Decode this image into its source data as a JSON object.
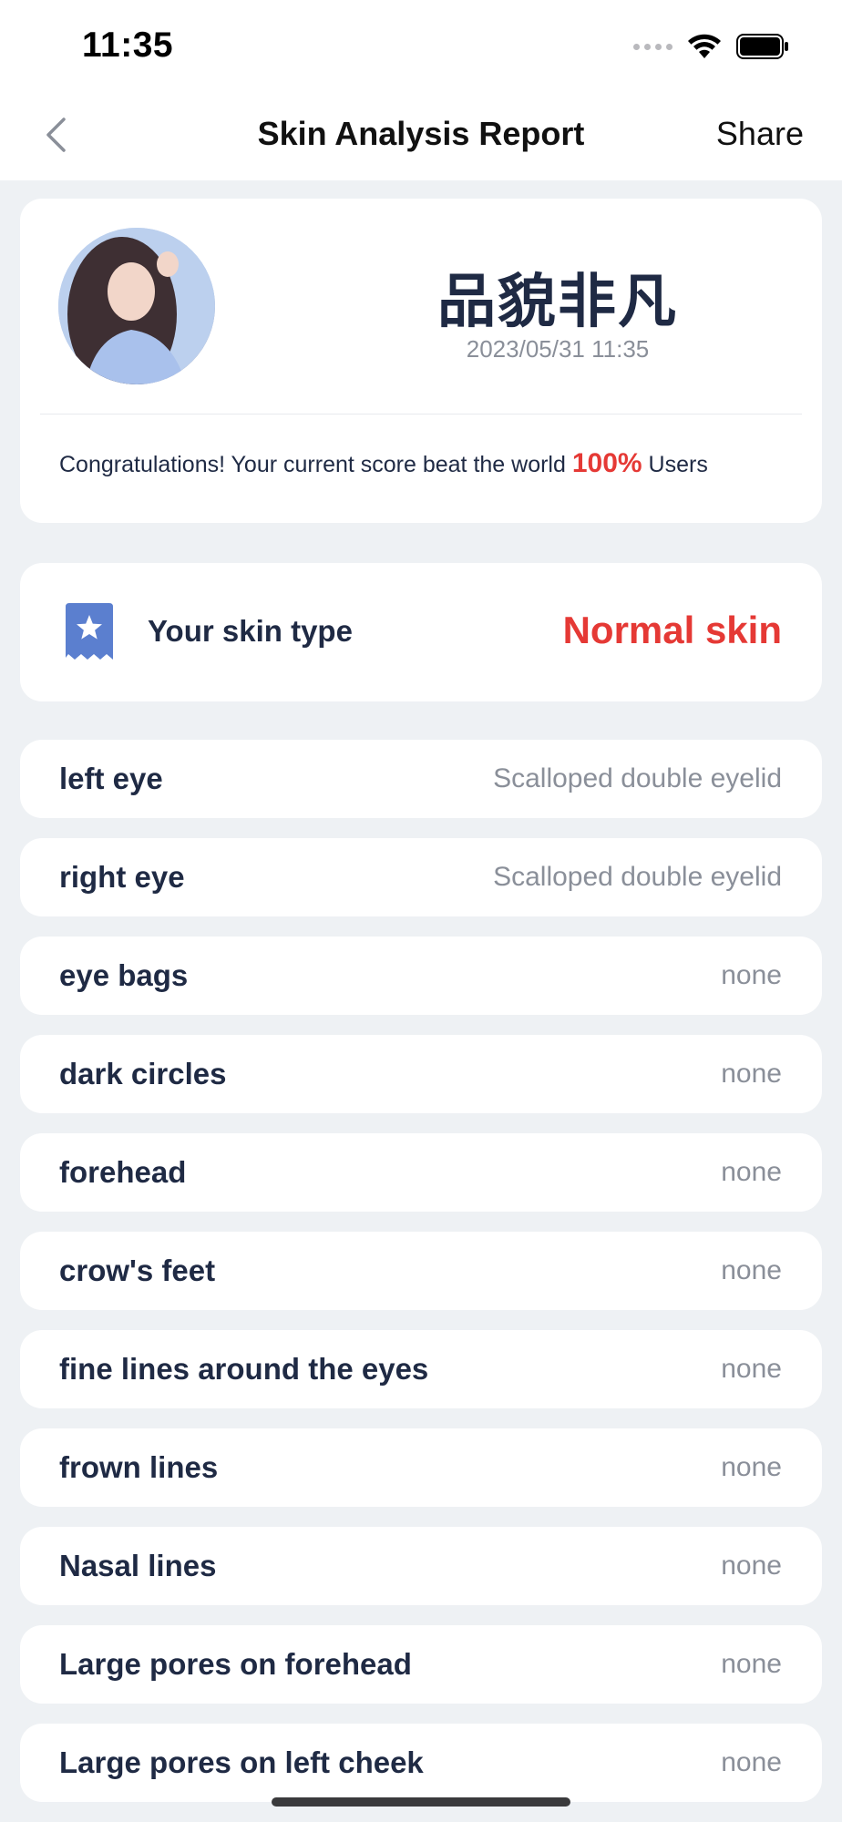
{
  "status_bar": {
    "time": "11:35"
  },
  "nav": {
    "title": "Skin Analysis Report",
    "share_label": "Share"
  },
  "profile": {
    "name": "品貌非凡",
    "date": "2023/05/31 11:35",
    "congrats_prefix": "Congratulations! Your current score beat the world",
    "congrats_percent": "100%",
    "congrats_suffix": "Users"
  },
  "skin_type": {
    "label": "Your skin type",
    "value": "Normal skin",
    "value_color": "#e53935",
    "icon": "ribbon-star-icon",
    "icon_color": "#5b7fcf"
  },
  "attributes": [
    {
      "label": "left eye",
      "value": "Scalloped double eyelid"
    },
    {
      "label": "right eye",
      "value": "Scalloped double eyelid"
    },
    {
      "label": "eye bags",
      "value": "none"
    },
    {
      "label": "dark circles",
      "value": "none"
    },
    {
      "label": "forehead",
      "value": "none"
    },
    {
      "label": "crow's feet",
      "value": "none"
    },
    {
      "label": "fine lines around the eyes",
      "value": "none"
    },
    {
      "label": "frown lines",
      "value": "none"
    },
    {
      "label": "Nasal lines",
      "value": "none"
    },
    {
      "label": "Large pores on forehead",
      "value": "none"
    },
    {
      "label": "Large pores on left cheek",
      "value": "none"
    }
  ]
}
